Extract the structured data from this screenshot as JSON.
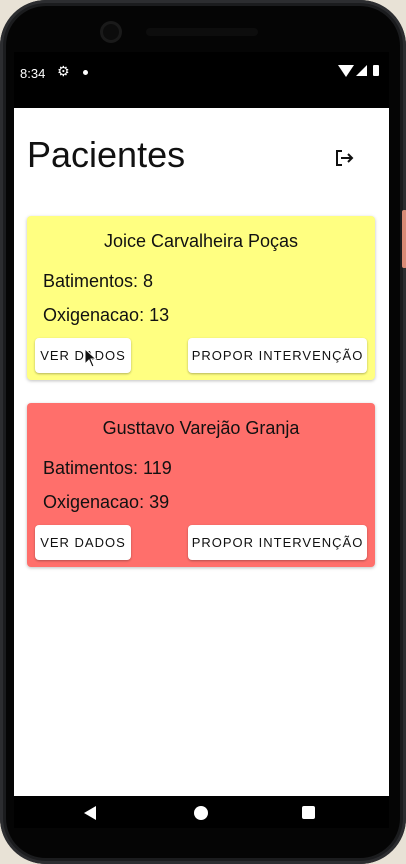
{
  "status_bar": {
    "time": "8:34",
    "settings_icon": "gear-icon",
    "notification_icon": "dot-icon",
    "wifi_icon": "wifi-icon",
    "signal_icon": "signal-icon",
    "battery_icon": "battery-icon"
  },
  "header": {
    "title": "Pacientes",
    "logout_icon": "logout-icon"
  },
  "patients": [
    {
      "name": "Joice Carvalheira Poças",
      "heart_rate_label": "Batimentos: 8",
      "oxygen_label": "Oxigenacao: 13",
      "view_button": "VER DADOS",
      "intervention_button": "PROPOR INTERVENÇÃO",
      "card_color": "#ffff81"
    },
    {
      "name": "Gusttavo Varejão Granja",
      "heart_rate_label": "Batimentos: 119",
      "oxygen_label": "Oxigenacao: 39",
      "view_button": "VER DADOS",
      "intervention_button": "PROPOR INTERVENÇÃO",
      "card_color": "#ff6f6b"
    }
  ],
  "nav_bar": {
    "back_icon": "back-icon",
    "home_icon": "home-icon",
    "recents_icon": "recents-icon"
  }
}
